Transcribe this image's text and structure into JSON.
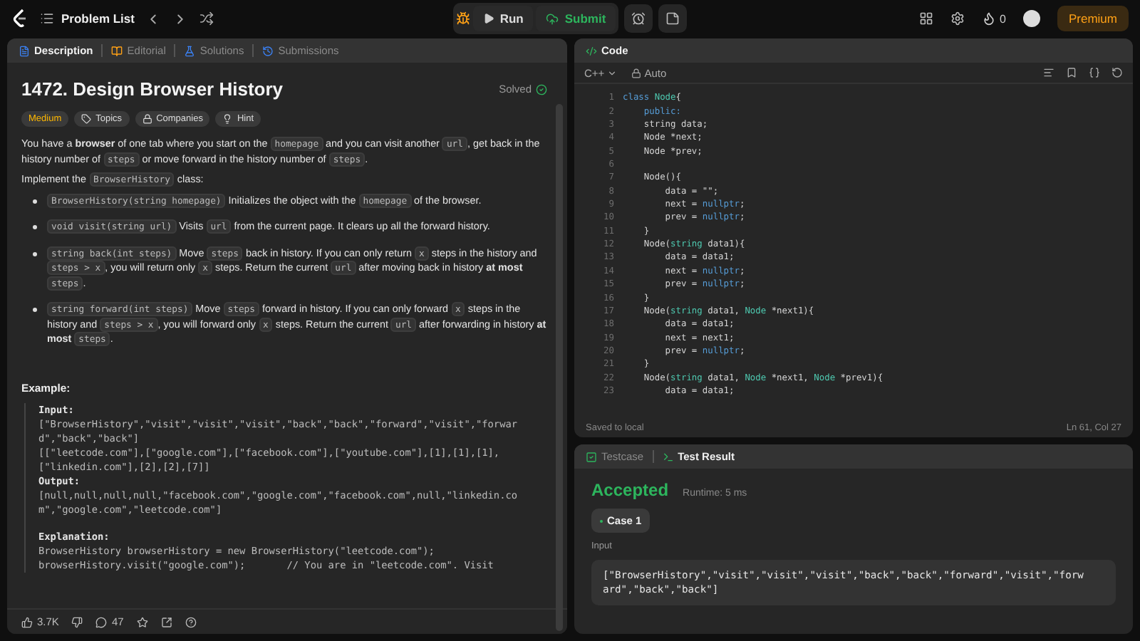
{
  "top_bar": {
    "problem_list": "Problem List",
    "run": "Run",
    "submit": "Submit",
    "streak": "0",
    "premium": "Premium"
  },
  "description_panel": {
    "tabs": [
      {
        "label": "Description",
        "kind": "description",
        "selected": true
      },
      {
        "label": "Editorial",
        "kind": "editorial",
        "selected": false
      },
      {
        "label": "Solutions",
        "kind": "solutions",
        "selected": false
      },
      {
        "label": "Submissions",
        "kind": "submissions",
        "selected": false
      }
    ],
    "title": "1472. Design Browser History",
    "status": "Solved",
    "tags": [
      {
        "label": "Medium",
        "kind": "difficulty"
      },
      {
        "label": "Topics",
        "kind": "topics"
      },
      {
        "label": "Companies",
        "kind": "companies"
      },
      {
        "label": "Hint",
        "kind": "hint"
      }
    ],
    "paragraphs": [
      [
        {
          "kind": "text",
          "text": "You have a "
        },
        {
          "kind": "bold",
          "text": "browser"
        },
        {
          "kind": "text",
          "text": " of one tab where you start on the "
        },
        {
          "kind": "code",
          "text": "homepage"
        },
        {
          "kind": "text",
          "text": " and you can visit another "
        },
        {
          "kind": "code",
          "text": "url"
        },
        {
          "kind": "text",
          "text": ", get back in the history number of "
        },
        {
          "kind": "code",
          "text": "steps"
        },
        {
          "kind": "text",
          "text": " or move forward in the history number of "
        },
        {
          "kind": "code",
          "text": "steps"
        },
        {
          "kind": "text",
          "text": "."
        }
      ],
      [
        {
          "kind": "text",
          "text": "Implement the "
        },
        {
          "kind": "code",
          "text": "BrowserHistory"
        },
        {
          "kind": "text",
          "text": " class:"
        }
      ]
    ],
    "bullets": [
      [
        {
          "kind": "code",
          "text": "BrowserHistory(string homepage)"
        },
        {
          "kind": "text",
          "text": " Initializes the object with the "
        },
        {
          "kind": "code",
          "text": "homepage"
        },
        {
          "kind": "text",
          "text": " of the browser."
        }
      ],
      [
        {
          "kind": "code",
          "text": "void visit(string url)"
        },
        {
          "kind": "text",
          "text": " Visits "
        },
        {
          "kind": "code",
          "text": "url"
        },
        {
          "kind": "text",
          "text": " from the current page. It clears up all the forward history."
        }
      ],
      [
        {
          "kind": "code",
          "text": "string back(int steps)"
        },
        {
          "kind": "text",
          "text": " Move "
        },
        {
          "kind": "code",
          "text": "steps"
        },
        {
          "kind": "text",
          "text": " back in history. If you can only return "
        },
        {
          "kind": "code",
          "text": "x"
        },
        {
          "kind": "text",
          "text": " steps in the history and "
        },
        {
          "kind": "code",
          "text": "steps > x"
        },
        {
          "kind": "text",
          "text": ", you will return only "
        },
        {
          "kind": "code",
          "text": "x"
        },
        {
          "kind": "text",
          "text": " steps. Return the current "
        },
        {
          "kind": "code",
          "text": "url"
        },
        {
          "kind": "text",
          "text": " after moving back in history "
        },
        {
          "kind": "bold",
          "text": "at most "
        },
        {
          "kind": "code",
          "text": "steps"
        },
        {
          "kind": "text",
          "text": "."
        }
      ],
      [
        {
          "kind": "code",
          "text": "string forward(int steps)"
        },
        {
          "kind": "text",
          "text": " Move "
        },
        {
          "kind": "code",
          "text": "steps"
        },
        {
          "kind": "text",
          "text": " forward in history. If you can only forward "
        },
        {
          "kind": "code",
          "text": "x"
        },
        {
          "kind": "text",
          "text": " steps in the history and "
        },
        {
          "kind": "code",
          "text": "steps > x"
        },
        {
          "kind": "text",
          "text": ", you will forward only "
        },
        {
          "kind": "code",
          "text": "x"
        },
        {
          "kind": "text",
          "text": " steps. Return the current "
        },
        {
          "kind": "code",
          "text": "url"
        },
        {
          "kind": "text",
          "text": " after forwarding in history "
        },
        {
          "kind": "bold",
          "text": "at most "
        },
        {
          "kind": "code",
          "text": "steps"
        },
        {
          "kind": "text",
          "text": "."
        }
      ]
    ],
    "example": {
      "heading": "Example:",
      "lines": [
        {
          "kind": "label",
          "text": "Input:"
        },
        {
          "kind": "value",
          "text": "[\"BrowserHistory\",\"visit\",\"visit\",\"visit\",\"back\",\"back\",\"forward\",\"visit\",\"forwar"
        },
        {
          "kind": "value",
          "text": "d\",\"back\",\"back\"]"
        },
        {
          "kind": "value",
          "text": "[[\"leetcode.com\"],[\"google.com\"],[\"facebook.com\"],[\"youtube.com\"],[1],[1],[1],"
        },
        {
          "kind": "value",
          "text": "[\"linkedin.com\"],[2],[2],[7]]"
        },
        {
          "kind": "label",
          "text": "Output:"
        },
        {
          "kind": "value",
          "text": "[null,null,null,null,\"facebook.com\",\"google.com\",\"facebook.com\",null,\"linkedin.co"
        },
        {
          "kind": "value",
          "text": "m\",\"google.com\",\"leetcode.com\"]"
        },
        {
          "kind": "section",
          "text": "Explanation:"
        },
        {
          "kind": "value",
          "text": "BrowserHistory browserHistory = new BrowserHistory(\"leetcode.com\");"
        },
        {
          "kind": "value",
          "text": "browserHistory.visit(\"google.com\");       // You are in \"leetcode.com\". Visit"
        }
      ]
    },
    "footer": {
      "likes": "3.7K",
      "comments": "47"
    }
  },
  "code_panel": {
    "title": "Code",
    "language": "C++",
    "mode": "Auto",
    "lines": [
      {
        "number": "1",
        "tokens": [
          {
            "kind": "keyword",
            "text": "class "
          },
          {
            "kind": "type",
            "text": "Node"
          },
          {
            "kind": "plain",
            "text": "{"
          }
        ]
      },
      {
        "number": "2",
        "tokens": [
          {
            "kind": "keyword",
            "text": "    public:"
          }
        ]
      },
      {
        "number": "3",
        "tokens": [
          {
            "kind": "plain",
            "text": "    string data;"
          }
        ]
      },
      {
        "number": "4",
        "tokens": [
          {
            "kind": "plain",
            "text": "    Node *next;"
          }
        ]
      },
      {
        "number": "5",
        "tokens": [
          {
            "kind": "plain",
            "text": "    Node *prev;"
          }
        ]
      },
      {
        "number": "6"
      },
      {
        "number": "7",
        "tokens": [
          {
            "kind": "plain",
            "text": "    Node(){"
          }
        ]
      },
      {
        "number": "8",
        "tokens": [
          {
            "kind": "plain",
            "text": "        data = \"\";"
          }
        ]
      },
      {
        "number": "9",
        "tokens": [
          {
            "kind": "plain",
            "text": "        next = "
          },
          {
            "kind": "constant",
            "text": "nullptr"
          },
          {
            "kind": "plain",
            "text": ";"
          }
        ]
      },
      {
        "number": "10",
        "tokens": [
          {
            "kind": "plain",
            "text": "        prev = "
          },
          {
            "kind": "constant",
            "text": "nullptr"
          },
          {
            "kind": "plain",
            "text": ";"
          }
        ]
      },
      {
        "number": "11",
        "tokens": [
          {
            "kind": "plain",
            "text": "    }"
          }
        ]
      },
      {
        "number": "12",
        "tokens": [
          {
            "kind": "plain",
            "text": "    Node("
          },
          {
            "kind": "type",
            "text": "string"
          },
          {
            "kind": "plain",
            "text": " data1){"
          }
        ]
      },
      {
        "number": "13",
        "tokens": [
          {
            "kind": "plain",
            "text": "        data = data1;"
          }
        ]
      },
      {
        "number": "14",
        "tokens": [
          {
            "kind": "plain",
            "text": "        next = "
          },
          {
            "kind": "constant",
            "text": "nullptr"
          },
          {
            "kind": "plain",
            "text": ";"
          }
        ]
      },
      {
        "number": "15",
        "tokens": [
          {
            "kind": "plain",
            "text": "        prev = "
          },
          {
            "kind": "constant",
            "text": "nullptr"
          },
          {
            "kind": "plain",
            "text": ";"
          }
        ]
      },
      {
        "number": "16",
        "tokens": [
          {
            "kind": "plain",
            "text": "    }"
          }
        ]
      },
      {
        "number": "17",
        "tokens": [
          {
            "kind": "plain",
            "text": "    Node("
          },
          {
            "kind": "type",
            "text": "string"
          },
          {
            "kind": "plain",
            "text": " data1, "
          },
          {
            "kind": "type",
            "text": "Node"
          },
          {
            "kind": "plain",
            "text": " *next1){"
          }
        ]
      },
      {
        "number": "18",
        "tokens": [
          {
            "kind": "plain",
            "text": "        data = data1;"
          }
        ]
      },
      {
        "number": "19",
        "tokens": [
          {
            "kind": "plain",
            "text": "        next = next1;"
          }
        ]
      },
      {
        "number": "20",
        "tokens": [
          {
            "kind": "plain",
            "text": "        prev = "
          },
          {
            "kind": "constant",
            "text": "nullptr"
          },
          {
            "kind": "plain",
            "text": ";"
          }
        ]
      },
      {
        "number": "21",
        "tokens": [
          {
            "kind": "plain",
            "text": "    }"
          }
        ]
      },
      {
        "number": "22",
        "tokens": [
          {
            "kind": "plain",
            "text": "    Node("
          },
          {
            "kind": "type",
            "text": "string"
          },
          {
            "kind": "plain",
            "text": " data1, "
          },
          {
            "kind": "type",
            "text": "Node"
          },
          {
            "kind": "plain",
            "text": " *next1, "
          },
          {
            "kind": "type",
            "text": "Node"
          },
          {
            "kind": "plain",
            "text": " *prev1){"
          }
        ]
      },
      {
        "number": "23",
        "tokens": [
          {
            "kind": "plain",
            "text": "        data = data1;"
          }
        ]
      }
    ],
    "save_status": "Saved to local",
    "cursor": "Ln 61, Col 27"
  },
  "test_panel": {
    "tabs": [
      {
        "label": "Testcase",
        "kind": "testcase",
        "selected": false
      },
      {
        "label": "Test Result",
        "kind": "result",
        "selected": true
      }
    ],
    "verdict": "Accepted",
    "runtime": "Runtime: 5 ms",
    "cases": [
      {
        "label": "Case 1",
        "selected": true
      }
    ],
    "input_label": "Input",
    "input_lines": [
      "[\"BrowserHistory\",\"visit\",\"visit\",\"visit\",\"back\",\"back\",\"forward\",\"visit\",\"forw",
      "ard\",\"back\",\"back\"]"
    ]
  }
}
